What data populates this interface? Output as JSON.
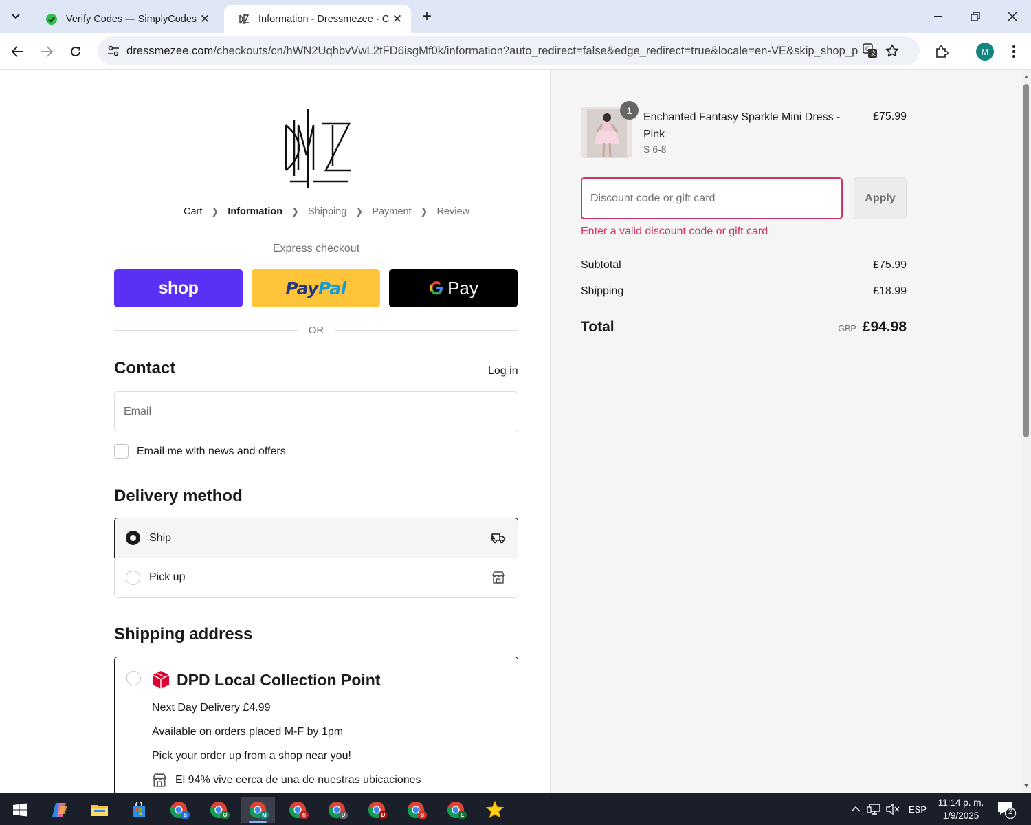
{
  "browser": {
    "tabs": [
      {
        "title": "Verify Codes — SimplyCodes",
        "active": false
      },
      {
        "title": "Information - Dressmezee - Ch",
        "active": true
      }
    ],
    "url_host": "dressmezee.com",
    "url_path": "/checkouts/cn/hWN2UqhbvVwL2tFD6isgMf0k/information?auto_redirect=false&edge_redirect=true&locale=en-VE&skip_shop_p...",
    "profile_initial": "M"
  },
  "checkout": {
    "breadcrumb": [
      {
        "label": "Cart",
        "state": "link"
      },
      {
        "label": "Information",
        "state": "current"
      },
      {
        "label": "Shipping",
        "state": "upcoming"
      },
      {
        "label": "Payment",
        "state": "upcoming"
      },
      {
        "label": "Review",
        "state": "upcoming"
      }
    ],
    "express_label": "Express checkout",
    "express_buttons": {
      "shop": "shop",
      "paypal_1": "Pay",
      "paypal_2": "Pal",
      "gpay": "Pay"
    },
    "or_label": "OR",
    "contact": {
      "title": "Contact",
      "login_link": "Log in",
      "email_placeholder": "Email",
      "newsletter_label": "Email me with news and offers"
    },
    "delivery": {
      "title": "Delivery method",
      "options": [
        {
          "label": "Ship",
          "selected": true,
          "icon": "truck-icon"
        },
        {
          "label": "Pick up",
          "selected": false,
          "icon": "store-icon"
        }
      ]
    },
    "shipping_address": {
      "title": "Shipping address",
      "dpd_title": "DPD Local Collection Point",
      "dpd_lines": [
        "Next Day Delivery £4.99",
        "Available on orders placed M-F by 1pm",
        "Pick your order up from a shop near you!"
      ],
      "dpd_note": "El 94% vive cerca de una de nuestras ubicaciones"
    }
  },
  "summary": {
    "item": {
      "quantity": "1",
      "name": "Enchanted Fantasy Sparkle Mini Dress - Pink",
      "variant": "S 6-8",
      "price": "£75.99"
    },
    "discount_placeholder": "Discount code or gift card",
    "apply_label": "Apply",
    "discount_error": "Enter a valid discount code or gift card",
    "subtotal_label": "Subtotal",
    "subtotal_value": "£75.99",
    "shipping_label": "Shipping",
    "shipping_value": "£18.99",
    "total_label": "Total",
    "total_currency": "GBP",
    "total_value": "£94.98"
  },
  "taskbar": {
    "chrome_badges": [
      "S",
      "O",
      "M",
      "S",
      "D",
      "D",
      "S",
      "E"
    ],
    "language": "ESP",
    "time": "11:14 p. m.",
    "date": "1/9/2025",
    "notification_count": "2"
  },
  "colors": {
    "shop_pay": "#5a31f4",
    "paypal": "#ffc439",
    "error": "#d2335f",
    "dpd_red": "#dc0032"
  }
}
